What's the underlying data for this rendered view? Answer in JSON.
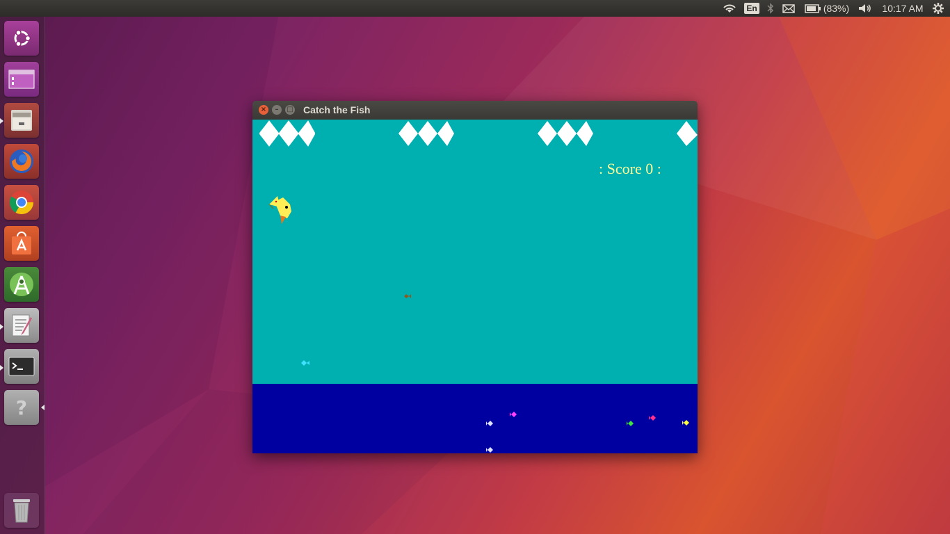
{
  "panel": {
    "keyboard_layout": "En",
    "battery": "(83%)",
    "clock": "10:17 AM"
  },
  "launcher": {
    "items": [
      {
        "name": "ubuntu-dash",
        "color": "#8f2a7a"
      },
      {
        "name": "workspace-switcher",
        "color": "#8a2a8a"
      },
      {
        "name": "files",
        "color": "#8a3a3a"
      },
      {
        "name": "firefox",
        "color": "#a83a2e"
      },
      {
        "name": "chrome",
        "color": "#b04038"
      },
      {
        "name": "software-center",
        "color": "#c84a2a"
      },
      {
        "name": "android-studio",
        "color": "#6a9a3a"
      },
      {
        "name": "text-editor",
        "color": "#9a9a9a"
      },
      {
        "name": "terminal",
        "color": "#8a8a8a"
      },
      {
        "name": "help",
        "color": "#8a8a8a"
      },
      {
        "name": "trash",
        "color": "#7a4a6a"
      }
    ]
  },
  "window": {
    "title": "Catch the Fish",
    "score_text": ": Score 0 :"
  },
  "colors": {
    "sky": "#00b0b0",
    "sea": "#0000a0",
    "score": "#ffff99",
    "bird": "#ffee55"
  }
}
